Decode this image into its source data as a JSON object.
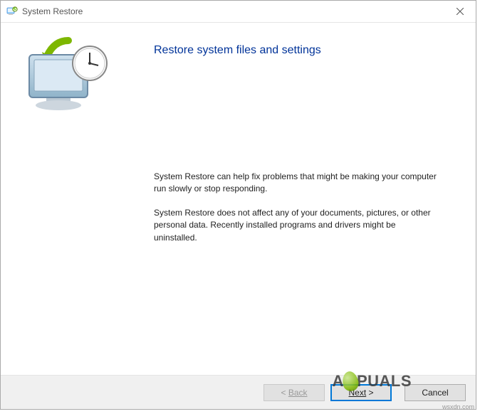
{
  "window": {
    "title": "System Restore"
  },
  "content": {
    "heading": "Restore system files and settings",
    "paragraph1": "System Restore can help fix problems that might be making your computer run slowly or stop responding.",
    "paragraph2": "System Restore does not affect any of your documents, pictures, or other personal data. Recently installed programs and drivers might be uninstalled."
  },
  "buttons": {
    "back_prefix": "< ",
    "back": "Back",
    "next_suffix": " >",
    "next": "Next",
    "cancel": "Cancel"
  },
  "watermark": "wsxdn.com",
  "logo_text_pre": "A",
  "logo_text_post": "PUALS"
}
